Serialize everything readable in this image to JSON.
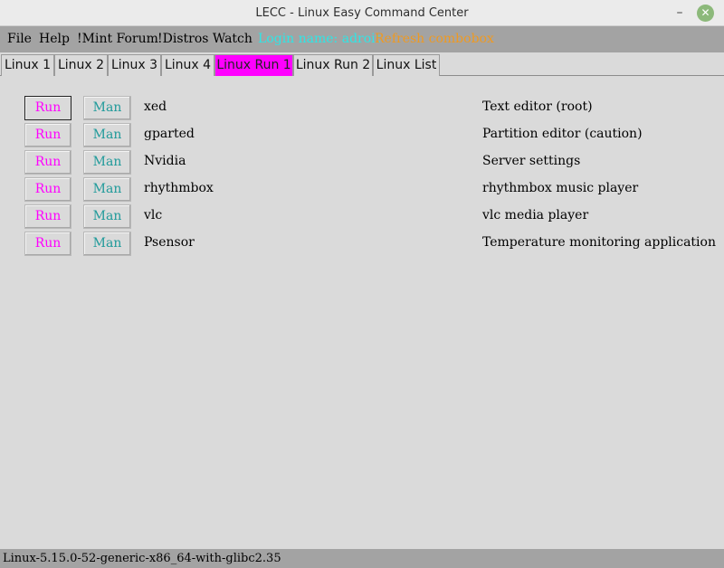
{
  "window": {
    "title": "LECC - Linux Easy Command Center",
    "minimize_glyph": "–",
    "close_glyph": "✕"
  },
  "menu": {
    "file": "File",
    "help": "Help",
    "mint_forum": "!Mint Forum",
    "distros_watch": "!Distros Watch",
    "login": "Login name: adroit",
    "refresh": "Refresh combobox"
  },
  "tabs": [
    {
      "label": "Linux 1"
    },
    {
      "label": "Linux 2"
    },
    {
      "label": "Linux 3"
    },
    {
      "label": "Linux 4"
    },
    {
      "label": "Linux Run 1"
    },
    {
      "label": "Linux Run 2"
    },
    {
      "label": "Linux List"
    }
  ],
  "active_tab": "Linux Run 1",
  "buttons": {
    "run": "Run",
    "man": "Man"
  },
  "rows": [
    {
      "command": "xed",
      "description": "Text editor (root)"
    },
    {
      "command": "gparted",
      "description": "Partition editor (caution)"
    },
    {
      "command": "Nvidia",
      "description": "Server settings"
    },
    {
      "command": "rhythmbox",
      "description": "rhythmbox music player"
    },
    {
      "command": "vlc",
      "description": "vlc media player"
    },
    {
      "command": "Psensor",
      "description": "Temperature monitoring application"
    }
  ],
  "status": "Linux-5.15.0-52-generic-x86_64-with-glibc2.35",
  "colors": {
    "active_tab": "#ff00ff",
    "run_text": "#ff00ff",
    "man_text": "#1f9a9a",
    "login_text": "#2ee6e6",
    "refresh_text": "#ef9a22",
    "menubar": "#a3a3a3"
  }
}
